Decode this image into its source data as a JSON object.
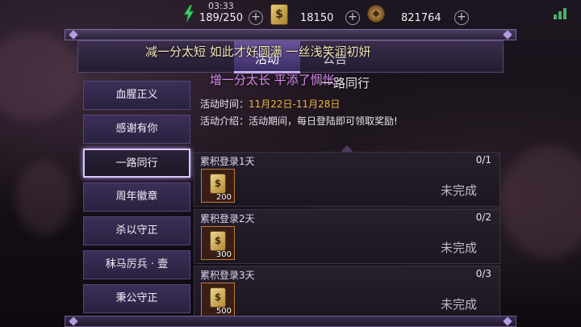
{
  "status": {
    "time": "03:33",
    "stamina": "189/250",
    "coins": "18150",
    "copper": "821764",
    "coin_icon_glyph": "$"
  },
  "tabs": [
    {
      "label": "活动",
      "active": true
    },
    {
      "label": "公告",
      "active": false
    }
  ],
  "banner": {
    "line1": "减一分太短  如此才好圆满  一丝浅笑润初妍",
    "line2": "增一分太长  平添了惆怅"
  },
  "activity": {
    "title": "一路同行",
    "time_label": "活动时间：",
    "time_value": "11月22日-11月28日",
    "desc_label": "活动介绍：",
    "desc_value": "活动期间，每日登陆即可领取奖励!"
  },
  "menu": [
    {
      "label": "血腥正义"
    },
    {
      "label": "感谢有你"
    },
    {
      "label": "一路同行",
      "active": true
    },
    {
      "label": "周年徽章"
    },
    {
      "label": "杀以守正"
    },
    {
      "label": "秣马厉兵 · 壹"
    },
    {
      "label": "秉公守正"
    }
  ],
  "tasks": [
    {
      "title": "累积登录1天",
      "progress": "0/1",
      "reward_qty": "200",
      "status": "未完成"
    },
    {
      "title": "累积登录2天",
      "progress": "0/2",
      "reward_qty": "300",
      "status": "未完成"
    },
    {
      "title": "累积登录3天",
      "progress": "0/3",
      "reward_qty": "500",
      "status": "未完成"
    }
  ],
  "colors": {
    "highlight": "#f2b33a",
    "active_tab": "#6a54a0",
    "stamina_icon": "#3fd06a"
  }
}
